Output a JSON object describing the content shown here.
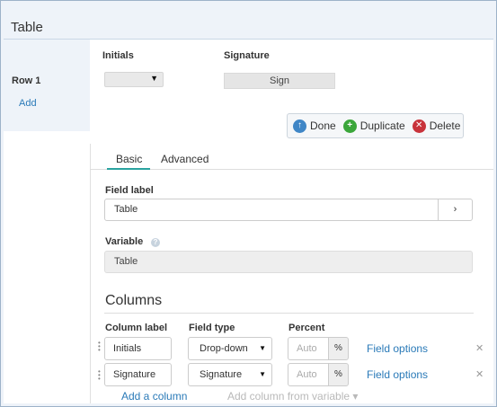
{
  "window": {
    "title": "Table"
  },
  "table": {
    "columns": [
      "Initials",
      "Signature"
    ],
    "row_label": "Row 1",
    "add_label": "Add",
    "sign_label": "Sign"
  },
  "toolbar": {
    "done": "Done",
    "duplicate": "Duplicate",
    "delete": "Delete"
  },
  "tabs": {
    "basic": "Basic",
    "advanced": "Advanced"
  },
  "field_label": {
    "label": "Field label",
    "value": "Table",
    "button": "›"
  },
  "variable": {
    "label": "Variable",
    "value": "Table"
  },
  "columns_section": {
    "title": "Columns",
    "headers": {
      "label": "Column label",
      "type": "Field type",
      "percent": "Percent"
    },
    "rows": [
      {
        "label": "Initials",
        "type": "Drop-down",
        "percent_placeholder": "Auto",
        "percent_addon": "%",
        "options": "Field options"
      },
      {
        "label": "Signature",
        "type": "Signature",
        "percent_placeholder": "Auto",
        "percent_addon": "%",
        "options": "Field options"
      }
    ],
    "add_column": "Add a column",
    "add_from_variable": "Add column from variable ▾"
  },
  "colors": {
    "accent": "#2aa3a0",
    "link": "#2a7ab8",
    "done": "#3f86c6",
    "duplicate": "#3aa63a",
    "delete": "#c8333b"
  },
  "icons": {
    "done": "up-arrow-circle-icon",
    "duplicate": "plus-circle-icon",
    "delete": "x-circle-icon"
  }
}
